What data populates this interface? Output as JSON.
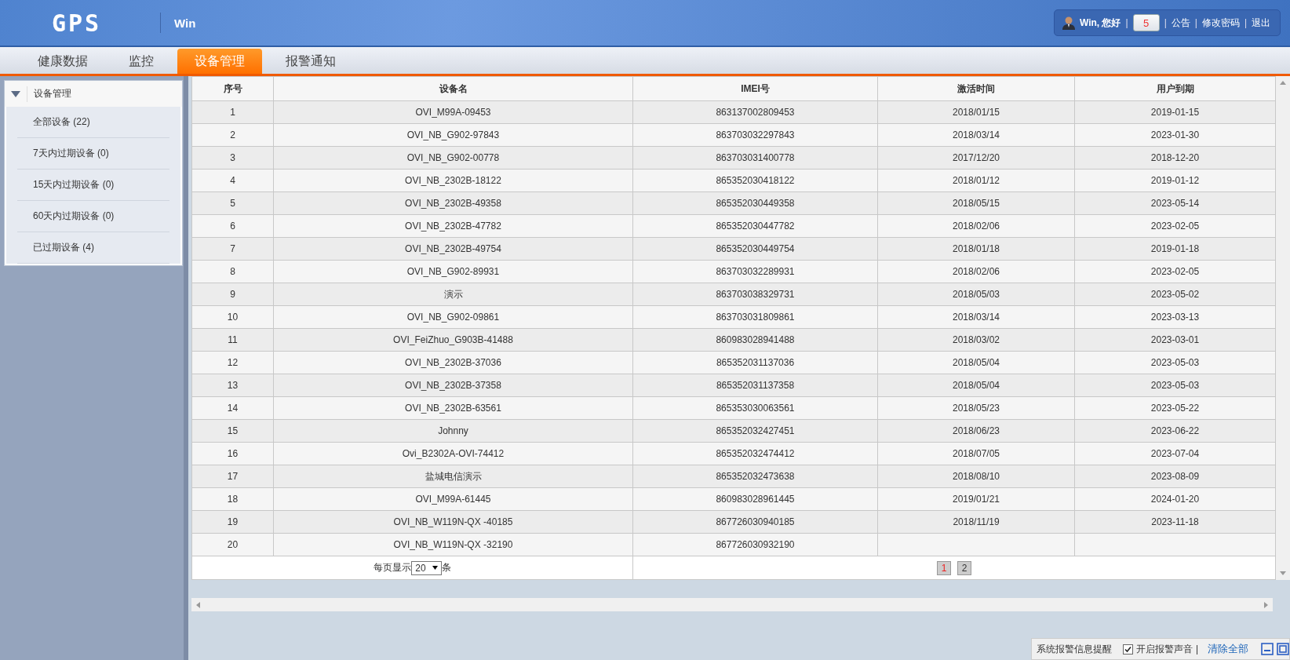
{
  "header": {
    "logo": "GPS",
    "account": "Win",
    "greeting": "Win, 您好",
    "message_count": "5",
    "separator": "|",
    "links": [
      "公告",
      "修改密码",
      "退出"
    ]
  },
  "tabs": [
    {
      "label": "健康数据",
      "selected": false
    },
    {
      "label": "监控",
      "selected": false
    },
    {
      "label": "设备管理",
      "selected": true
    },
    {
      "label": "报警通知",
      "selected": false
    }
  ],
  "sidebar": {
    "title": "设备管理",
    "expanded": true,
    "items": [
      {
        "label": "全部设备 (22)"
      },
      {
        "label": "7天内过期设备 (0)"
      },
      {
        "label": "15天内过期设备 (0)"
      },
      {
        "label": "60天内过期设备 (0)"
      },
      {
        "label": "已过期设备 (4)"
      }
    ]
  },
  "table": {
    "columns": [
      "序号",
      "设备名",
      "IMEI号",
      "激活时间",
      "用户到期"
    ],
    "rows": [
      [
        "1",
        "OVI_M99A-09453",
        "863137002809453",
        "2018/01/15",
        "2019-01-15"
      ],
      [
        "2",
        "OVI_NB_G902-97843",
        "863703032297843",
        "2018/03/14",
        "2023-01-30"
      ],
      [
        "3",
        "OVI_NB_G902-00778",
        "863703031400778",
        "2017/12/20",
        "2018-12-20"
      ],
      [
        "4",
        "OVI_NB_2302B-18122",
        "865352030418122",
        "2018/01/12",
        "2019-01-12"
      ],
      [
        "5",
        "OVI_NB_2302B-49358",
        "865352030449358",
        "2018/05/15",
        "2023-05-14"
      ],
      [
        "6",
        "OVI_NB_2302B-47782",
        "865352030447782",
        "2018/02/06",
        "2023-02-05"
      ],
      [
        "7",
        "OVI_NB_2302B-49754",
        "865352030449754",
        "2018/01/18",
        "2019-01-18"
      ],
      [
        "8",
        "OVI_NB_G902-89931",
        "863703032289931",
        "2018/02/06",
        "2023-02-05"
      ],
      [
        "9",
        "演示",
        "863703038329731",
        "2018/05/03",
        "2023-05-02"
      ],
      [
        "10",
        "OVI_NB_G902-09861",
        "863703031809861",
        "2018/03/14",
        "2023-03-13"
      ],
      [
        "11",
        "OVI_FeiZhuo_G903B-41488",
        "860983028941488",
        "2018/03/02",
        "2023-03-01"
      ],
      [
        "12",
        "OVI_NB_2302B-37036",
        "865352031137036",
        "2018/05/04",
        "2023-05-03"
      ],
      [
        "13",
        "OVI_NB_2302B-37358",
        "865352031137358",
        "2018/05/04",
        "2023-05-03"
      ],
      [
        "14",
        "OVI_NB_2302B-63561",
        "865353030063561",
        "2018/05/23",
        "2023-05-22"
      ],
      [
        "15",
        "Johnny",
        "865352032427451",
        "2018/06/23",
        "2023-06-22"
      ],
      [
        "16",
        "Ovi_B2302A-OVI-74412",
        "865352032474412",
        "2018/07/05",
        "2023-07-04"
      ],
      [
        "17",
        "盐城电信演示",
        "865352032473638",
        "2018/08/10",
        "2023-08-09"
      ],
      [
        "18",
        "OVI_M99A-61445",
        "860983028961445",
        "2019/01/21",
        "2024-01-20"
      ],
      [
        "19",
        "OVI_NB_W119N-QX -40185",
        "867726030940185",
        "2018/11/19",
        "2023-11-18"
      ],
      [
        "20",
        "OVI_NB_W119N-QX -32190",
        "867726030932190",
        "",
        ""
      ]
    ]
  },
  "pagination": {
    "prefix": "每页显示",
    "page_size": "20",
    "suffix": "条",
    "pages": [
      {
        "label": "1",
        "selected": true
      },
      {
        "label": "2",
        "selected": false
      }
    ]
  },
  "alert_bar": {
    "title": "系统报警信息提醒",
    "sound": {
      "label": "开启报警声音",
      "checked": true
    },
    "separator": "|",
    "clear": "清除全部"
  }
}
